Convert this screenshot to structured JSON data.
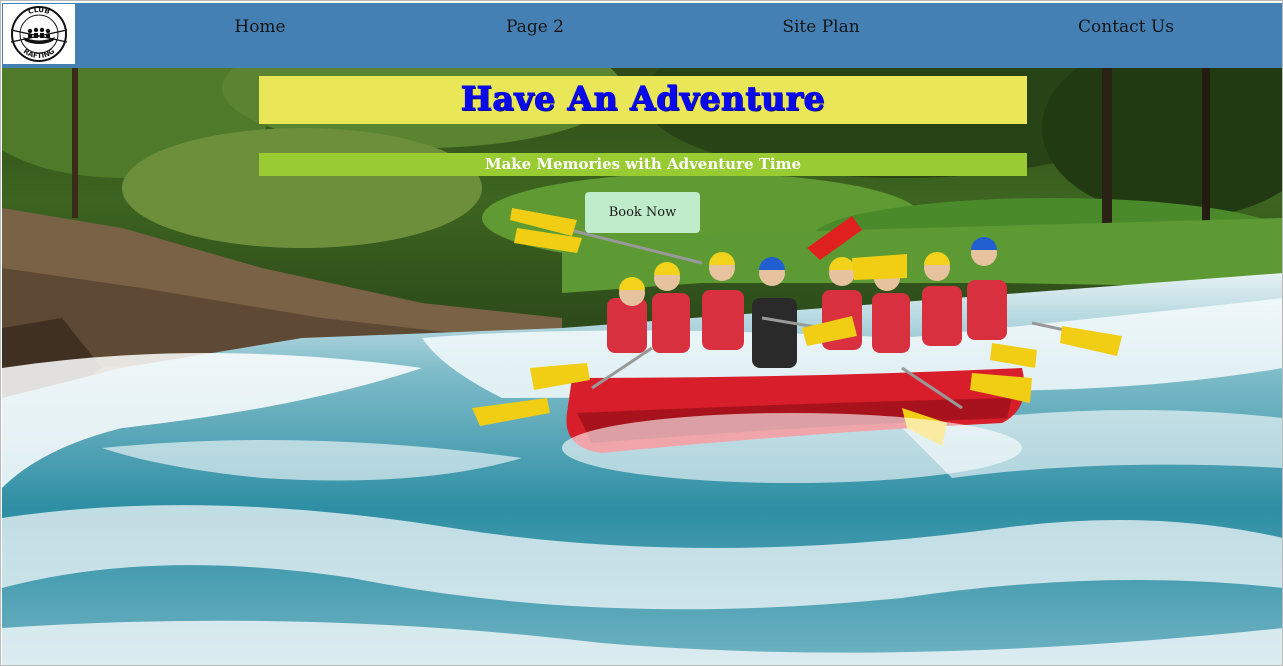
{
  "nav": {
    "logo_alt": "Club Rafting",
    "logo_top": "CLUB",
    "logo_bottom": "RAFTING",
    "items": [
      {
        "label": "Home"
      },
      {
        "label": "Page 2"
      },
      {
        "label": "Site Plan"
      },
      {
        "label": "Contact Us"
      }
    ]
  },
  "hero": {
    "title": "Have An Adventure",
    "subtitle": "Make Memories with Adventure Time",
    "button_label": "Book Now",
    "image_alt": "Group of people white water rafting in a red raft"
  },
  "colors": {
    "nav_background": "#4580b4",
    "title_background": "#e9e758",
    "title_text": "#0a0ae8",
    "subtitle_background": "#99cc33",
    "button_background": "#bfeccb"
  }
}
